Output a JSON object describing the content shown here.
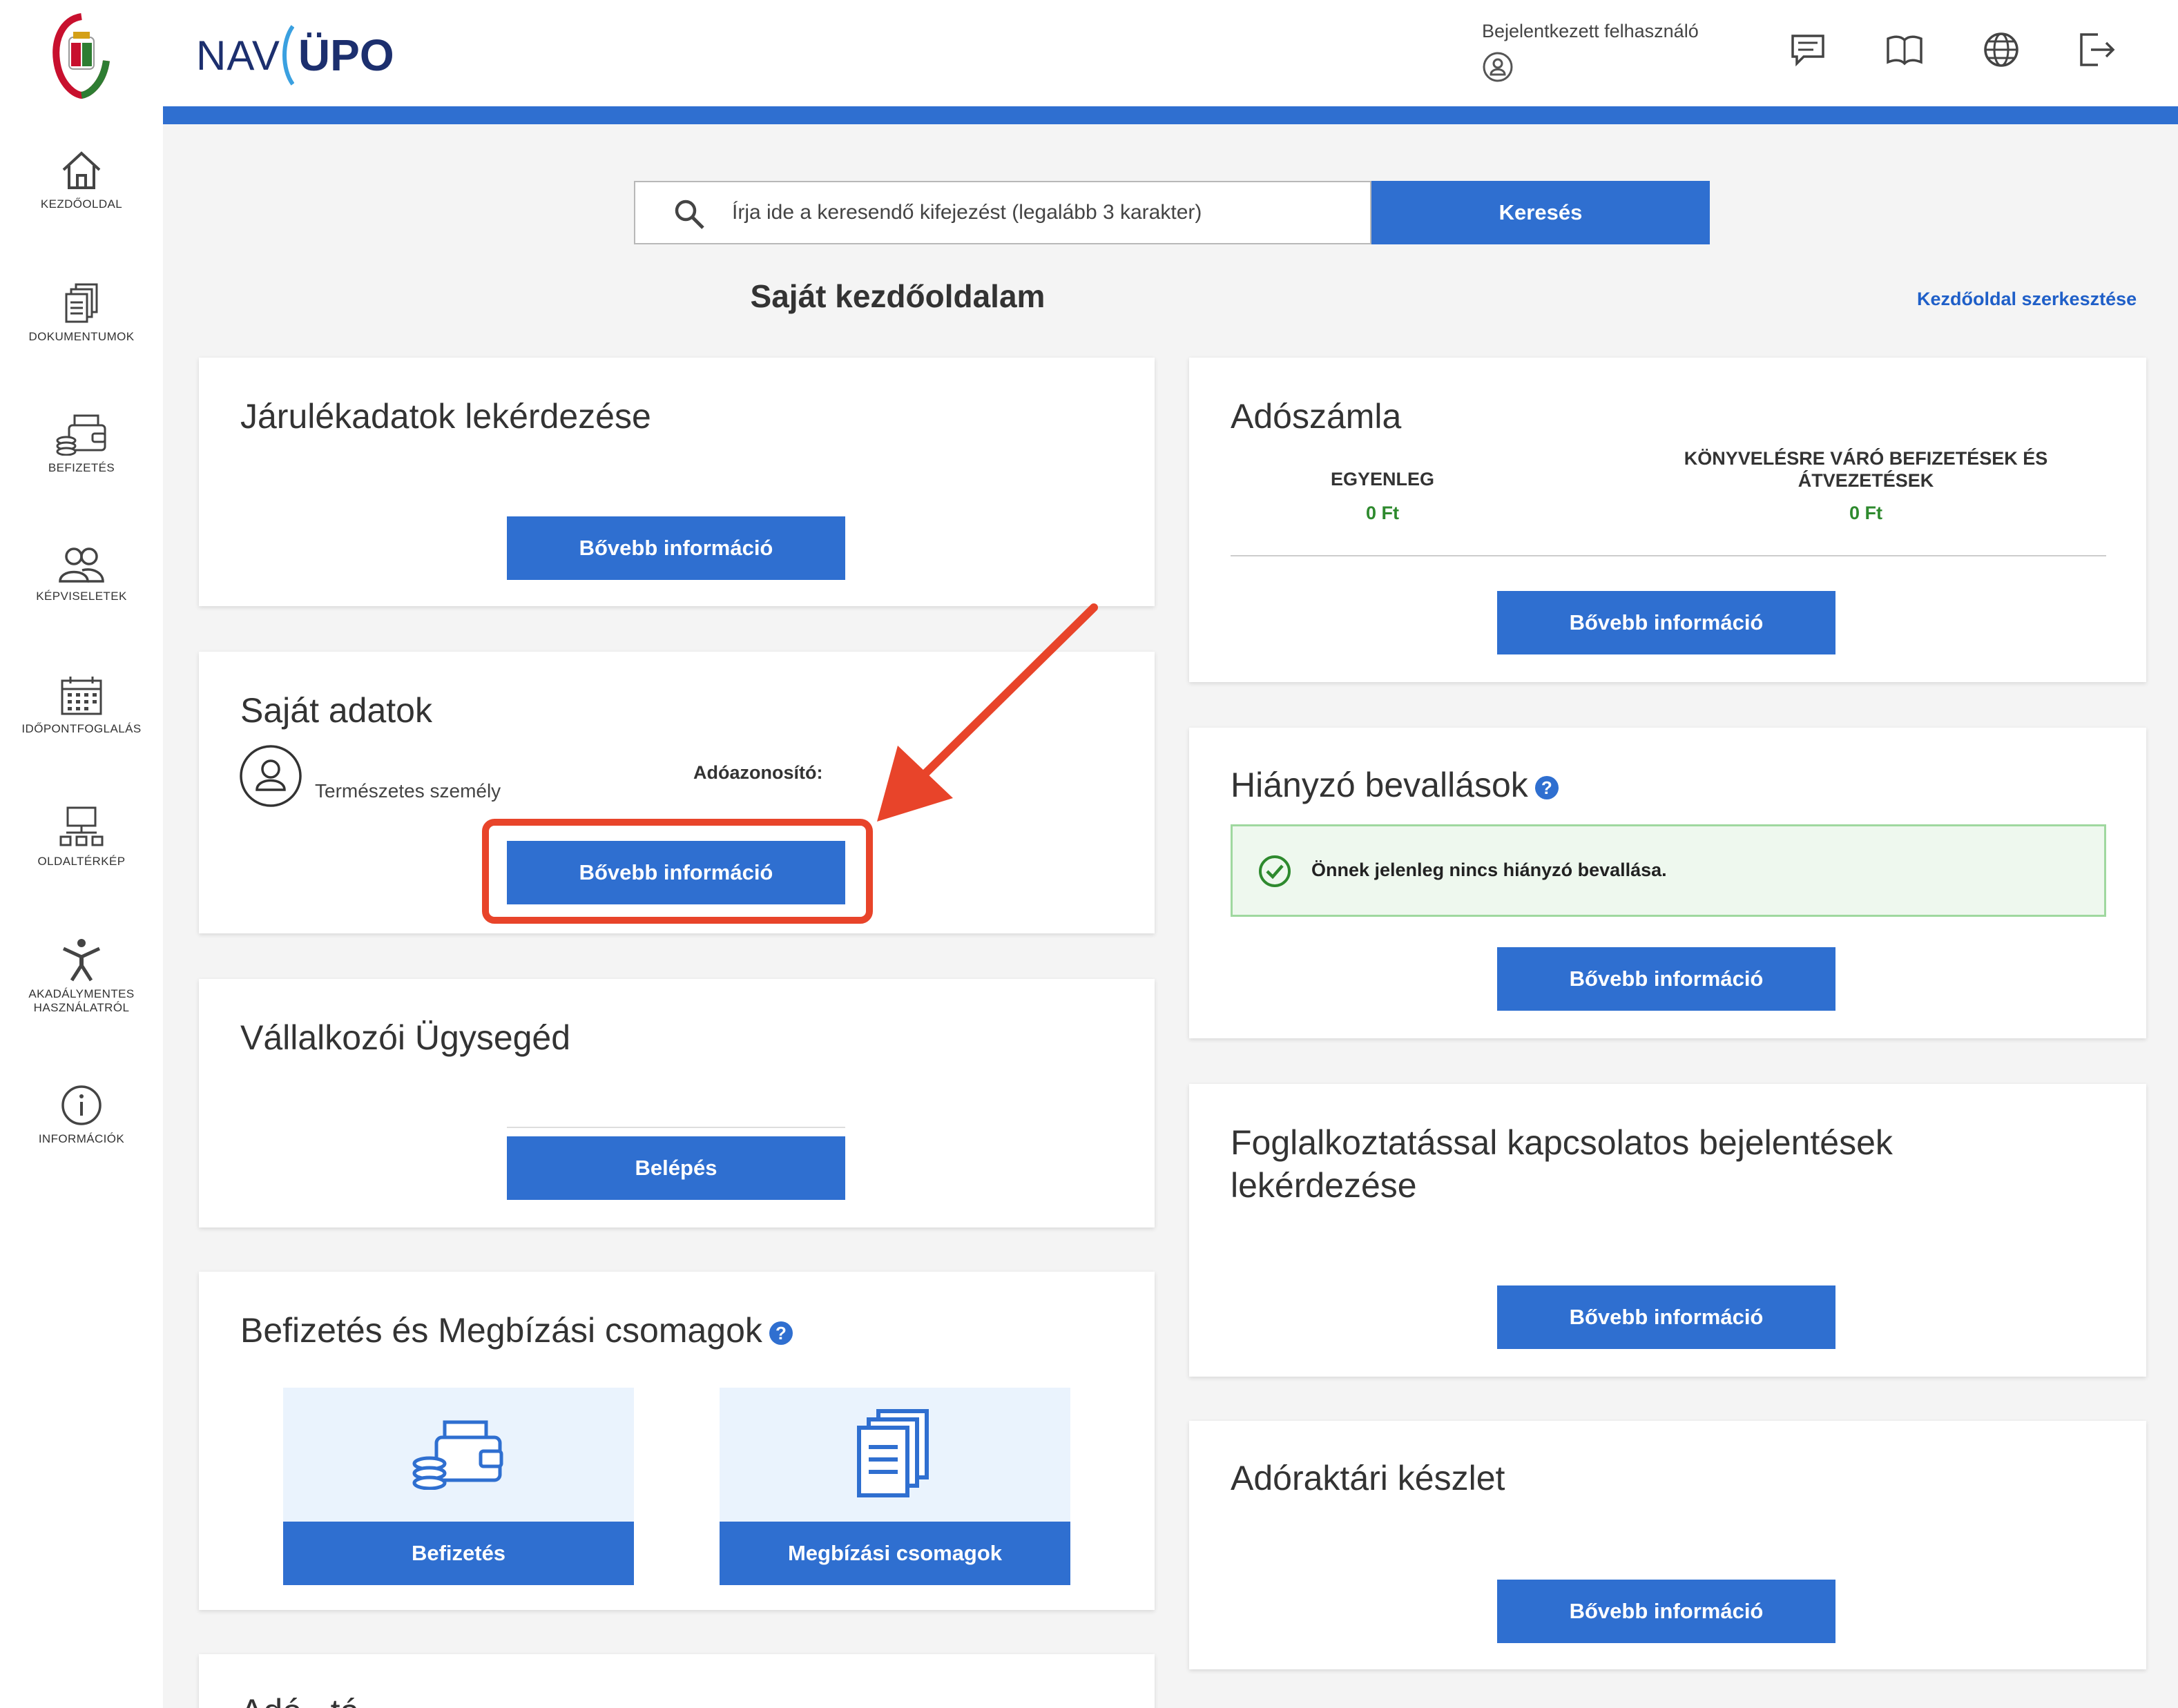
{
  "brand": {
    "nav": "NAV",
    "upo": "ÜPO"
  },
  "header": {
    "user_label": "Bejelentkezett felhasználó"
  },
  "sidebar": {
    "items": [
      {
        "label": "KEZDŐOLDAL",
        "icon": "home-icon"
      },
      {
        "label": "DOKUMENTUMOK",
        "icon": "documents-icon"
      },
      {
        "label": "BEFIZETÉS",
        "icon": "wallet-icon"
      },
      {
        "label": "KÉPVISELETEK",
        "icon": "people-icon"
      },
      {
        "label": "IDŐPONTFOGLALÁS",
        "icon": "calendar-icon"
      },
      {
        "label": "OLDALTÉRKÉP",
        "icon": "sitemap-icon"
      },
      {
        "label": "AKADÁLYMENTES",
        "label2": "HASZNÁLATRÓL",
        "icon": "accessibility-icon"
      },
      {
        "label": "INFORMÁCIÓK",
        "icon": "info-icon"
      }
    ]
  },
  "search": {
    "placeholder": "Írja ide a keresendő kifejezést (legalább 3 karakter)",
    "button": "Keresés"
  },
  "page": {
    "title": "Saját kezdőoldalam",
    "edit_link": "Kezdőoldal szerkesztése"
  },
  "cards": {
    "jarulek": {
      "title": "Járulékadatok lekérdezése",
      "button": "Bővebb információ"
    },
    "sajat": {
      "title": "Saját adatok",
      "person_type": "Természetes személy",
      "tax_id_label": "Adóazonosító:",
      "button": "Bővebb információ"
    },
    "vallalkozoi": {
      "title": "Vállalkozói Ügysegéd",
      "button": "Belépés"
    },
    "befizetes": {
      "title": "Befizetés és Megbízási csomagok",
      "tile1": "Befizetés",
      "tile2": "Megbízási csomagok"
    },
    "adoszamla": {
      "title": "Adószámla",
      "col1_head": "EGYENLEG",
      "col1_value": "0 Ft",
      "col2_head_1": "KÖNYVELÉSRE VÁRÓ BEFIZETÉSEK ÉS",
      "col2_head_2": "ÁTVEZETÉSEK",
      "col2_value": "0 Ft",
      "button": "Bővebb információ"
    },
    "hianyzo": {
      "title": "Hiányzó bevallások",
      "message": "Önnek jelenleg nincs hiányzó bevallása.",
      "button": "Bővebb információ"
    },
    "foglalkoztatas": {
      "title_1": "Foglalkoztatással kapcsolatos bejelentések",
      "title_2": "lekérdezése",
      "button": "Bővebb információ"
    },
    "adoraktari": {
      "title": "Adóraktári készlet",
      "button": "Bővebb információ"
    },
    "partial": {
      "title": "Adó...tá..."
    }
  },
  "colors": {
    "primary": "#2f6fd0",
    "brand_dark": "#1c2f6e",
    "success": "#2e8a2e",
    "annotation": "#e8442a"
  }
}
